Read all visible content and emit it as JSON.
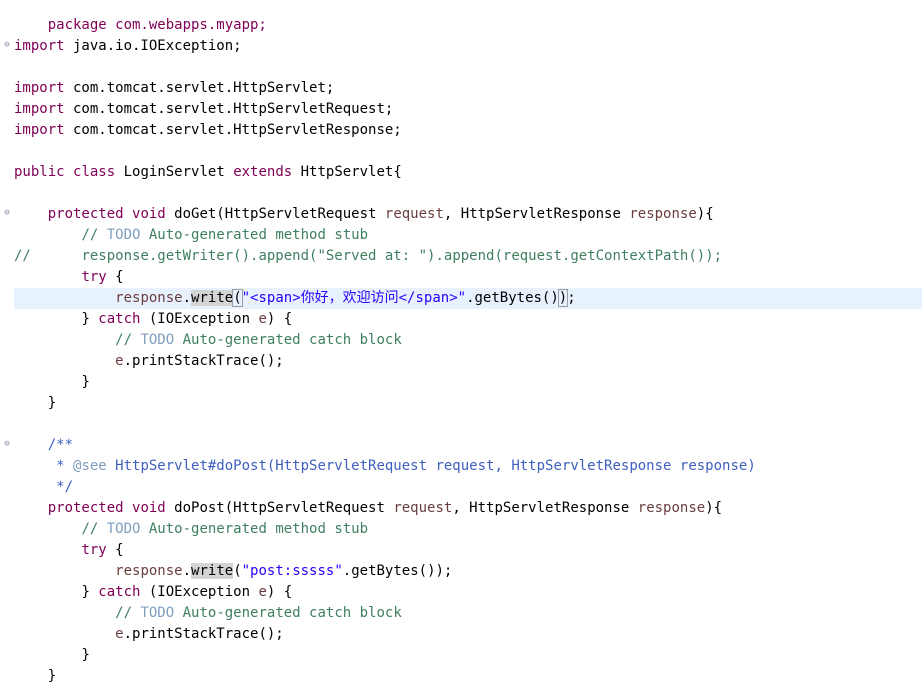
{
  "code": {
    "l1": "package com.webapps.myapp;",
    "l3_kw": "import",
    "l3_rest": " java.io.IOException;",
    "l5_kw": "import",
    "l5_rest": " com.tomcat.servlet.HttpServlet;",
    "l6_kw": "import",
    "l6_rest": " com.tomcat.servlet.HttpServletRequest;",
    "l7_kw": "import",
    "l7_rest": " com.tomcat.servlet.HttpServletResponse;",
    "l9_kw1": "public",
    "l9_kw2": "class",
    "l9_name": " LoginServlet ",
    "l9_kw3": "extends",
    "l9_rest": " HttpServlet{",
    "l11_kw1": "protected",
    "l11_kw2": "void",
    "l11_sig1": " doGet(HttpServletRequest ",
    "l11_p1": "request",
    "l11_sig2": ", HttpServletResponse ",
    "l11_p2": "response",
    "l11_sig3": "){",
    "l12_cm": "// ",
    "l12_todo": "TODO",
    "l12_rest": " Auto-generated method stub",
    "l13_cm": "//",
    "l13_code1": "response.getWriter().append(",
    "l13_str": "\"Served at: \"",
    "l13_code2": ").append(",
    "l13_p": "request",
    "l13_code3": ".getContextPath());",
    "l14_kw": "try",
    "l14_rest": " {",
    "l15_p": "response",
    "l15_dot": ".",
    "l15_m": "write",
    "l15_open": "(",
    "l15_str": "\"<span>你好，欢迎访问</span>\"",
    "l15_rest": ".getBytes()",
    "l15_close": ")",
    "l15_semi": ";",
    "l16_open": "} ",
    "l16_kw": "catch",
    "l16_mid": " (IOException ",
    "l16_p": "e",
    "l16_end": ") {",
    "l17_cm": "// ",
    "l17_todo": "TODO",
    "l17_rest": " Auto-generated catch block",
    "l18_p": "e",
    "l18_rest": ".printStackTrace();",
    "l19": "}",
    "l20": "}",
    "l22": "/**",
    "l23_star": " * ",
    "l23_tag": "@see",
    "l23_rest": " HttpServlet#doPost(HttpServletRequest request, HttpServletResponse response)",
    "l24": " */",
    "l25_kw1": "protected",
    "l25_kw2": "void",
    "l25_sig1": " doPost(HttpServletRequest ",
    "l25_p1": "request",
    "l25_sig2": ", HttpServletResponse ",
    "l25_p2": "response",
    "l25_sig3": "){",
    "l26_cm": "// ",
    "l26_todo": "TODO",
    "l26_rest": " Auto-generated method stub",
    "l27_kw": "try",
    "l27_rest": " {",
    "l28_p": "response",
    "l28_dot": ".",
    "l28_m": "write",
    "l28_open": "(",
    "l28_str": "\"post:sssss\"",
    "l28_rest": ".getBytes());",
    "l29_open": "} ",
    "l29_kw": "catch",
    "l29_mid": " (IOException ",
    "l29_p": "e",
    "l29_end": ") {",
    "l30_cm": "// ",
    "l30_todo": "TODO",
    "l30_rest": " Auto-generated catch block",
    "l31_p": "e",
    "l31_rest": ".printStackTrace();",
    "l32": "}",
    "l33": "}"
  },
  "icons": {
    "fold": "fold-collapse-icon"
  },
  "colors": {
    "keyword": "#7f0055",
    "comment": "#3f7f5f",
    "todo": "#7f9fbf",
    "string": "#2a00ff",
    "javadoc": "#3f5fbf",
    "current_line": "#e8f2fe"
  }
}
